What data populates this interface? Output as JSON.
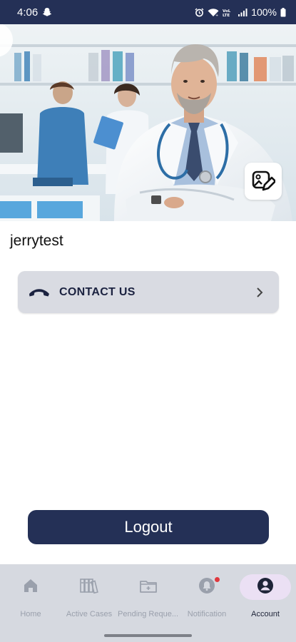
{
  "status_bar": {
    "time": "4:06",
    "battery": "100%"
  },
  "profile": {
    "username": "jerrytest"
  },
  "contact": {
    "label": "CONTACT US"
  },
  "logout": {
    "label": "Logout"
  },
  "bottom_nav": {
    "items": [
      {
        "label": "Home",
        "icon": "home-icon"
      },
      {
        "label": "Active Cases",
        "icon": "cases-icon"
      },
      {
        "label": "Pending Reque...",
        "icon": "folder-icon"
      },
      {
        "label": "Notification",
        "icon": "bell-icon"
      },
      {
        "label": "Account",
        "icon": "account-icon",
        "active": true
      }
    ]
  },
  "colors": {
    "primary": "#243056",
    "card": "#d9dbe2",
    "nav_bg": "#d6d9e0",
    "active_pill": "#ebe0f4",
    "badge": "#e0383e"
  }
}
